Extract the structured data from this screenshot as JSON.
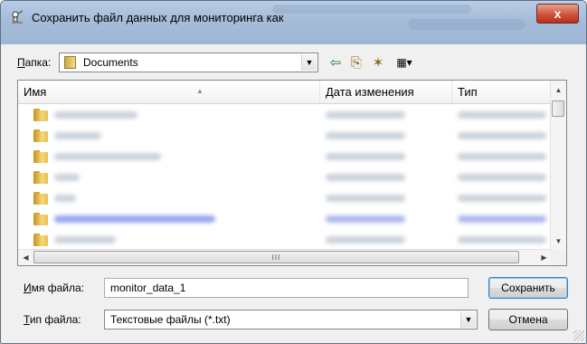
{
  "window": {
    "title": "Сохранить файл данных для мониторинга как",
    "close_glyph": "x"
  },
  "location": {
    "label_underlined": "П",
    "label_rest": "апка:",
    "value": "Documents"
  },
  "toolbar": {
    "back_glyph": "⇦",
    "up_glyph": "⎘",
    "new_folder_glyph": "✶",
    "view_menu_glyph": "▦▾"
  },
  "file_list": {
    "columns": [
      "Имя",
      "Дата изменения",
      "Тип"
    ],
    "hscroll_grip": "III",
    "rows": [
      {
        "name_color": "#b9c3cf",
        "date_color": "#b9c3cf",
        "type_color": "#b9c3cf"
      },
      {
        "name_color": "#b9c3cf",
        "date_color": "#b9c3cf",
        "type_color": "#b9c3cf"
      },
      {
        "name_color": "#b9c3cf",
        "date_color": "#b9c3cf",
        "type_color": "#b9c3cf"
      },
      {
        "name_color": "#b9c3cf",
        "date_color": "#b9c3cf",
        "type_color": "#b9c3cf"
      },
      {
        "name_color": "#b9c3cf",
        "date_color": "#b9c3cf",
        "type_color": "#b9c3cf"
      },
      {
        "name_color": "#6f86e8",
        "date_color": "#8fa0ea",
        "type_color": "#8fa0ea"
      },
      {
        "name_color": "#b9c3cf",
        "date_color": "#b9c3cf",
        "type_color": "#b9c3cf"
      }
    ]
  },
  "filename": {
    "label_underlined": "И",
    "label_rest": "мя файла:",
    "value": "monitor_data_1"
  },
  "filetype": {
    "label_underlined": "Т",
    "label_rest": "ип файла:",
    "value": "Текстовые файлы (*.txt)"
  },
  "buttons": {
    "save": "Сохранить",
    "cancel": "Отмена"
  },
  "colors": {
    "title_bar": "#a6bdd9",
    "close_button": "#d0533c",
    "window_bg": "#f0f0f0"
  }
}
